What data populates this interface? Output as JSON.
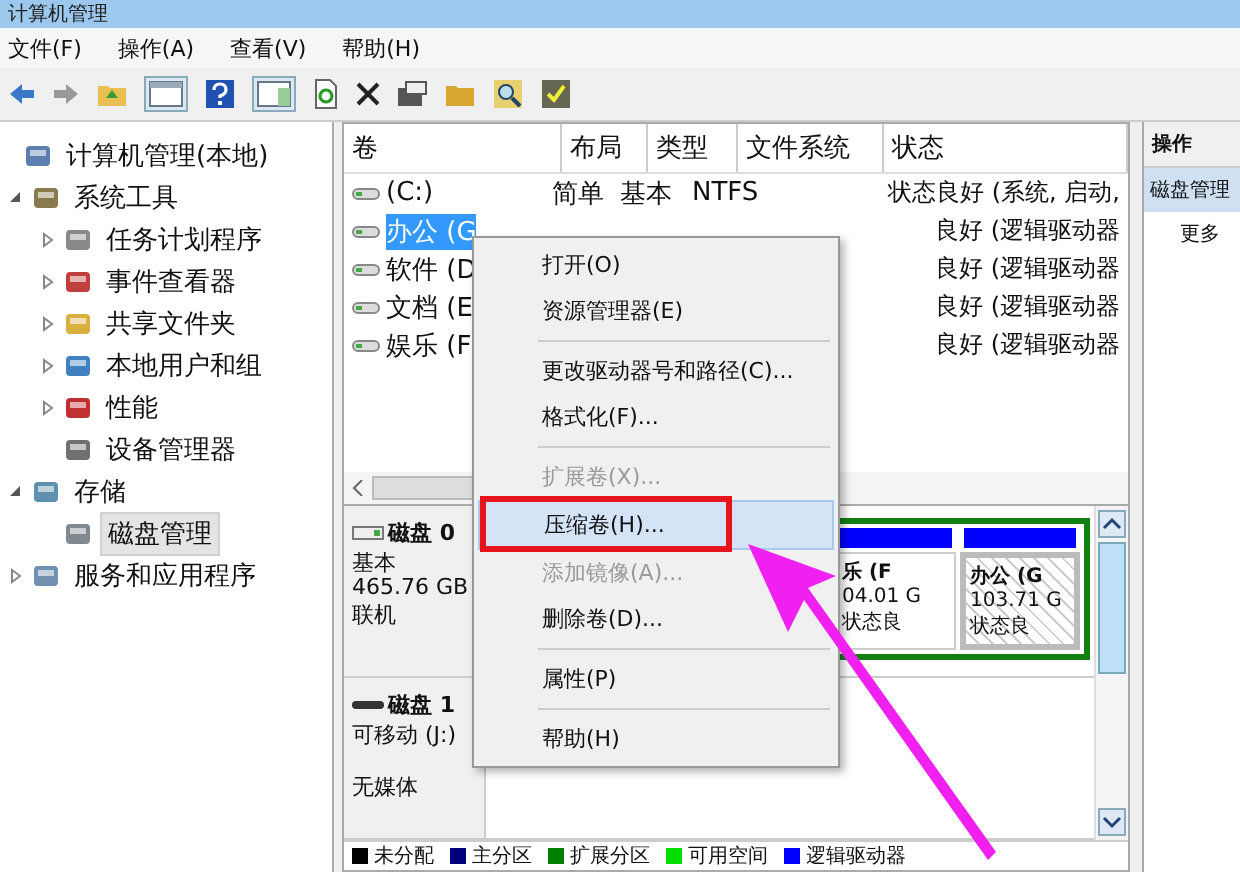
{
  "window": {
    "title": "计算机管理"
  },
  "menu_bar": [
    "文件(F)",
    "操作(A)",
    "查看(V)",
    "帮助(H)"
  ],
  "tree": [
    {
      "label": "计算机管理(本地)",
      "selected": false,
      "children": [
        {
          "label": "系统工具",
          "selected": false,
          "expanded": true,
          "children": [
            {
              "label": "任务计划程序",
              "selected": false,
              "expanded": false
            },
            {
              "label": "事件查看器",
              "selected": false,
              "expanded": false
            },
            {
              "label": "共享文件夹",
              "selected": false,
              "expanded": false
            },
            {
              "label": "本地用户和组",
              "selected": false,
              "expanded": false
            },
            {
              "label": "性能",
              "selected": false,
              "expanded": false
            },
            {
              "label": "设备管理器",
              "selected": false
            }
          ]
        },
        {
          "label": "存储",
          "selected": false,
          "expanded": true,
          "children": [
            {
              "label": "磁盘管理",
              "selected": true
            }
          ]
        },
        {
          "label": "服务和应用程序",
          "selected": false,
          "expanded": false
        }
      ]
    }
  ],
  "volumes": {
    "columns": [
      "卷",
      "布局",
      "类型",
      "文件系统",
      "状态"
    ],
    "rows": [
      {
        "name": "(C:)",
        "layout": "简单",
        "type": "基本",
        "file_system": "NTFS",
        "status": "状态良好 (系统, 启动,",
        "selected": false
      },
      {
        "name": "办公 (G",
        "status": "良好 (逻辑驱动器",
        "selected": true
      },
      {
        "name": "软件 (D",
        "status": "良好 (逻辑驱动器",
        "selected": false
      },
      {
        "name": "文档 (E",
        "status": "良好 (逻辑驱动器",
        "selected": false
      },
      {
        "name": "娱乐 (F",
        "status": "良好 (逻辑驱动器",
        "selected": false
      }
    ]
  },
  "context_menu": [
    {
      "kind": "item",
      "label": "打开(O)",
      "disabled": false,
      "selected": false
    },
    {
      "kind": "item",
      "label": "资源管理器(E)",
      "disabled": false,
      "selected": false
    },
    {
      "kind": "separator"
    },
    {
      "kind": "item",
      "label": "更改驱动器号和路径(C)...",
      "disabled": false,
      "selected": false
    },
    {
      "kind": "item",
      "label": "格式化(F)...",
      "disabled": false,
      "selected": false
    },
    {
      "kind": "separator"
    },
    {
      "kind": "item",
      "label": "扩展卷(X)...",
      "disabled": true,
      "selected": false
    },
    {
      "kind": "item",
      "label": "压缩卷(H)...",
      "disabled": false,
      "selected": true
    },
    {
      "kind": "item",
      "label": "添加镜像(A)...",
      "disabled": true,
      "selected": false
    },
    {
      "kind": "item",
      "label": "删除卷(D)...",
      "disabled": false,
      "selected": false
    },
    {
      "kind": "separator"
    },
    {
      "kind": "item",
      "label": "属性(P)",
      "disabled": false,
      "selected": false
    },
    {
      "kind": "separator"
    },
    {
      "kind": "item",
      "label": "帮助(H)",
      "disabled": false,
      "selected": false
    }
  ],
  "disks": [
    {
      "name": "磁盘 0",
      "kind": "fixed",
      "lines": [
        "基本",
        "465.76 GB",
        "联机"
      ],
      "partitions": [
        {
          "lines": [
            "乐 (F",
            "04.01 G",
            "状态良"
          ],
          "selected": false
        },
        {
          "lines": [
            "办公 (G",
            "103.71 G",
            "状态良"
          ],
          "selected": true
        }
      ]
    },
    {
      "name": "磁盘 1",
      "kind": "removable",
      "lines": [
        "可移动 (J:)",
        "无媒体"
      ]
    }
  ],
  "legend": [
    {
      "label": "未分配",
      "color": "#000000"
    },
    {
      "label": "主分区",
      "color": "#00007f"
    },
    {
      "label": "扩展分区",
      "color": "#007f00"
    },
    {
      "label": "可用空间",
      "color": "#00e000"
    },
    {
      "label": "逻辑驱动器",
      "color": "#0000ff"
    }
  ],
  "actions": {
    "title": "操作",
    "items": [
      {
        "label": "磁盘管理",
        "selected": true
      },
      {
        "label": "更多",
        "selected": false
      }
    ]
  }
}
